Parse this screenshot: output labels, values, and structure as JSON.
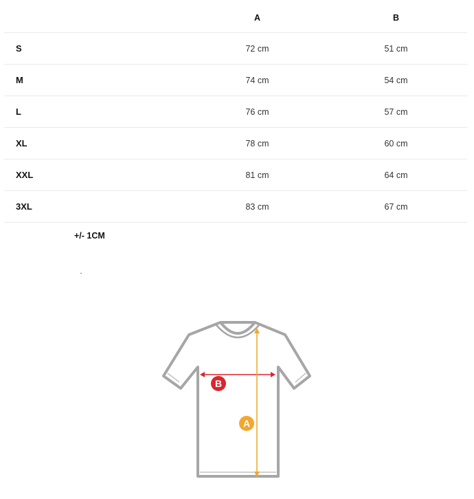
{
  "table": {
    "headers": [
      "",
      "A",
      "B"
    ],
    "rows": [
      {
        "size": "S",
        "a": "72 cm",
        "b": "51 cm"
      },
      {
        "size": "M",
        "a": "74 cm",
        "b": "54 cm"
      },
      {
        "size": "L",
        "a": "76 cm",
        "b": "57 cm"
      },
      {
        "size": "XL",
        "a": "78 cm",
        "b": "60 cm"
      },
      {
        "size": "XXL",
        "a": "81 cm",
        "b": "64 cm"
      },
      {
        "size": "3XL",
        "a": "83 cm",
        "b": "67 cm"
      }
    ]
  },
  "tolerance": "+/- 1CM",
  "diagram": {
    "label_a": "A",
    "label_b": "B",
    "color_a": "#f0a830",
    "color_b": "#d9262e",
    "shirt_outline": "#a6a6a6"
  }
}
